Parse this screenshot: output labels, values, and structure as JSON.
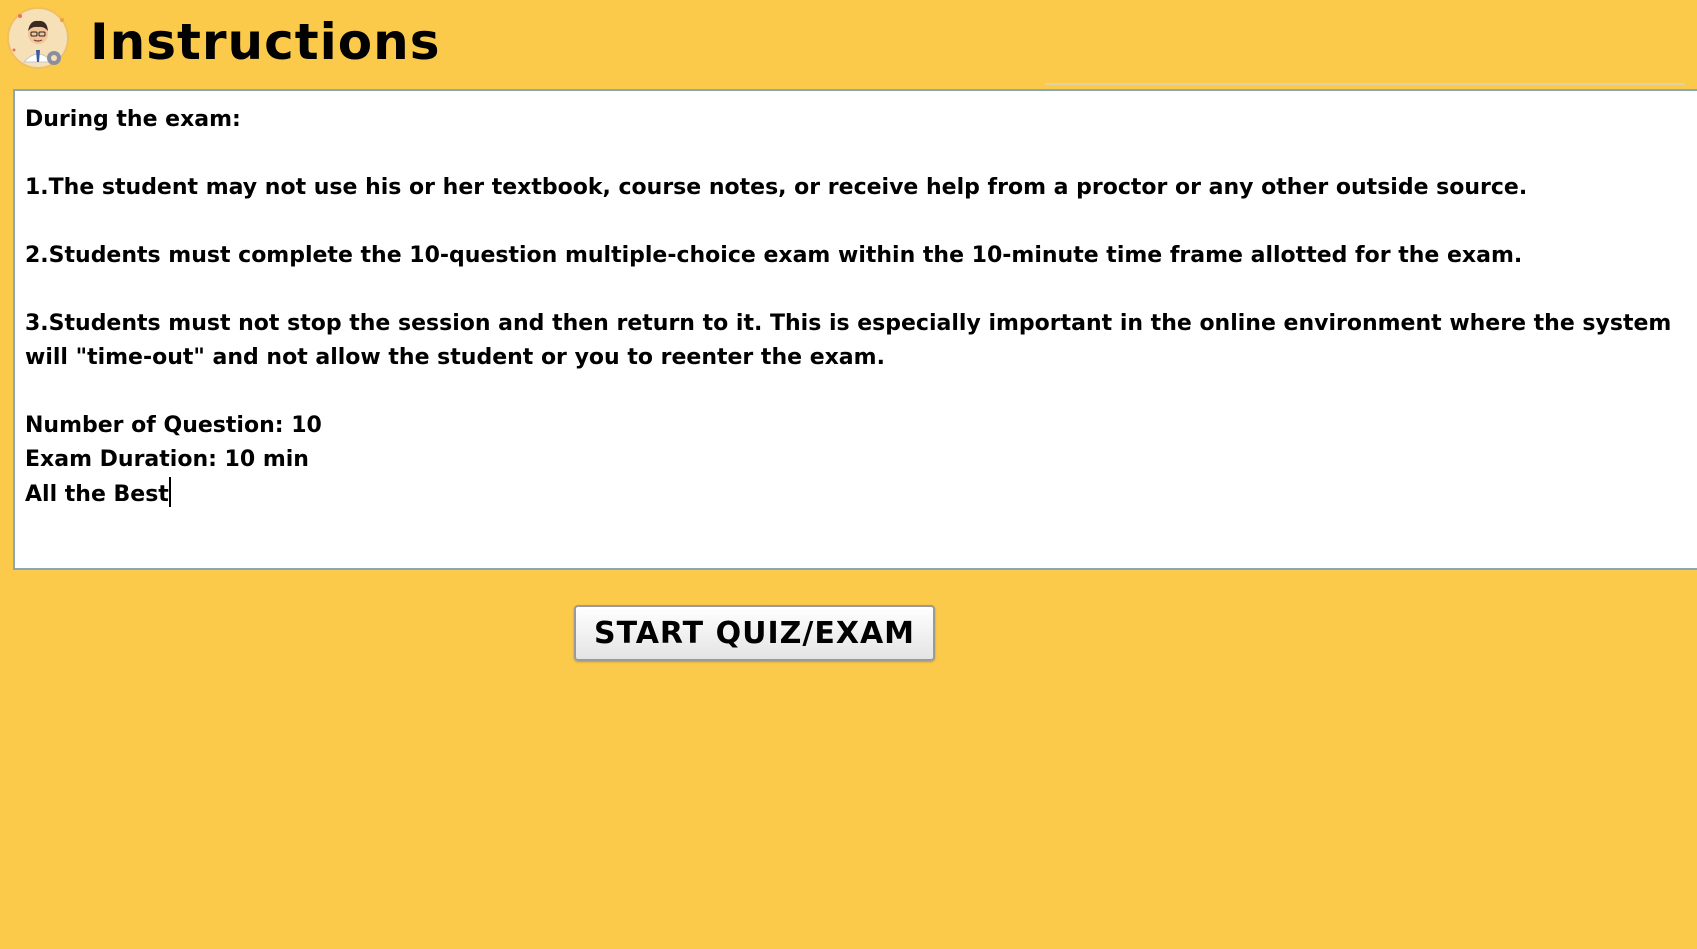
{
  "header": {
    "title": "Instructions",
    "avatar_icon": "teacher-avatar-icon"
  },
  "instructions": {
    "intro": "During the exam:",
    "rules": [
      "1.The student may not use his or her textbook, course notes, or receive help from a proctor or any other outside source.",
      "2.Students must complete the 10-question multiple-choice exam within the 10-minute time frame allotted for the exam.",
      "3.Students must not stop the session and then return to it. This is especially important in the online environment where the system",
      "will \"time-out\" and not allow the student or you to reenter the exam."
    ],
    "number_of_questions": "Number of Question: 10",
    "exam_duration": "Exam Duration: 10 min",
    "closing": "All the Best"
  },
  "actions": {
    "start_label": "START QUIZ/EXAM"
  },
  "colors": {
    "background": "#FCCA4B",
    "box_border": "#8aa6b8"
  }
}
